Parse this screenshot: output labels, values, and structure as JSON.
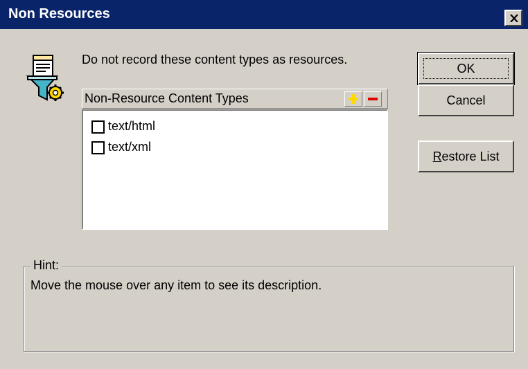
{
  "window": {
    "title": "Non Resources"
  },
  "description": "Do not record these content types as resources.",
  "list": {
    "header": "Non-Resource Content Types",
    "items": [
      {
        "label": "text/html",
        "checked": false
      },
      {
        "label": "text/xml",
        "checked": false
      }
    ]
  },
  "buttons": {
    "ok": "OK",
    "cancel": "Cancel",
    "restore_mnemonic": "R",
    "restore_rest": "estore List"
  },
  "hint": {
    "legend": "Hint:",
    "text": "Move the mouse over any item to see its description."
  },
  "icons": {
    "app": "document-filter-gear-icon",
    "add": "plus-icon",
    "remove": "minus-icon",
    "close": "close-icon"
  },
  "colors": {
    "titlebar": "#0a246a",
    "face": "#d4d0c8",
    "add_icon": "#ffd800",
    "remove_icon": "#e00000"
  }
}
